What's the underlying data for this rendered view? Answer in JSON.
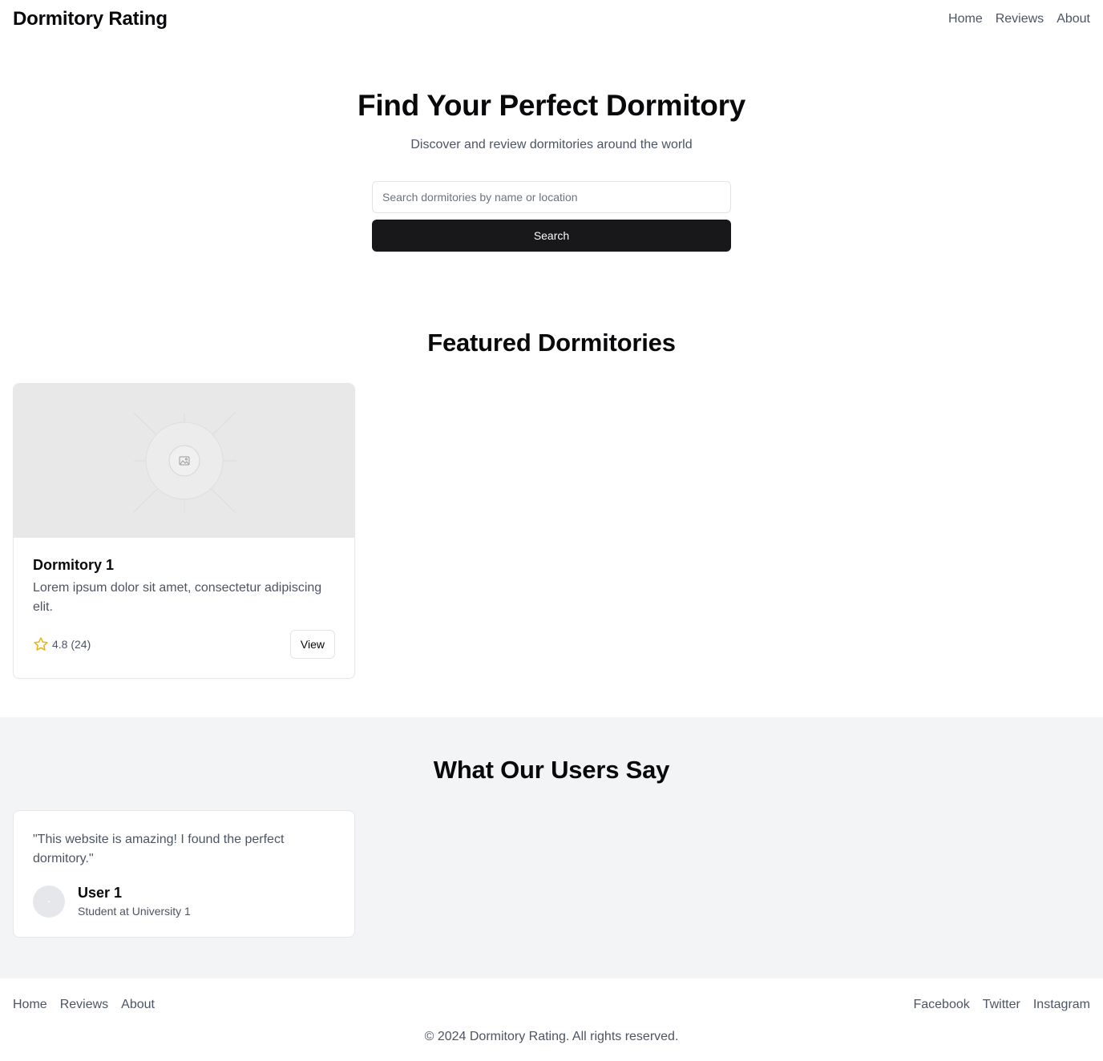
{
  "nav": {
    "brand": "Dormitory Rating",
    "links": [
      "Home",
      "Reviews",
      "About"
    ]
  },
  "hero": {
    "title": "Find Your Perfect Dormitory",
    "subtitle": "Discover and review dormitories around the world",
    "search_placeholder": "Search dormitories by name or location",
    "search_button": "Search"
  },
  "featured": {
    "title": "Featured Dormitories",
    "cards": [
      {
        "title": "Dormitory 1",
        "description": "Lorem ipsum dolor sit amet, consectetur adipiscing elit.",
        "rating": "4.8 (24)",
        "button": "View",
        "image_icon": "image-placeholder-icon"
      }
    ]
  },
  "testimonials": {
    "title": "What Our Users Say",
    "items": [
      {
        "quote": "\"This website is amazing! I found the perfect dormitory.\"",
        "name": "User 1",
        "role": "Student at University 1"
      }
    ]
  },
  "footer": {
    "links": [
      "Home",
      "Reviews",
      "About"
    ],
    "social": [
      "Facebook",
      "Twitter",
      "Instagram"
    ],
    "copyright": "© 2024 Dormitory Rating. All rights reserved."
  },
  "colors": {
    "primary_button": "#18181b",
    "star": "#eab308",
    "muted_text": "#4b5563",
    "section_bg": "#f3f4f6"
  }
}
